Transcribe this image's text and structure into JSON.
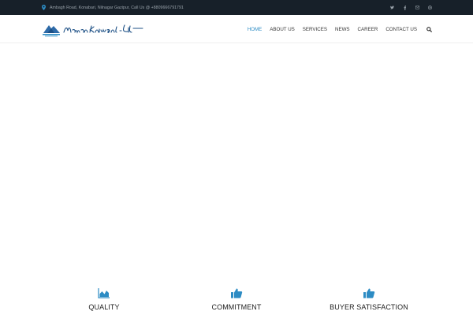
{
  "topbar": {
    "address": "Ambagh Road, Konabari, Nilnagar Gazipur, Call Us @ +8809666791791",
    "social_icons": [
      "twitter-icon",
      "facebook-icon",
      "email-icon",
      "pinterest-icon"
    ]
  },
  "header": {
    "logo_text": "Mamun Knitwear Ltd.",
    "nav": [
      {
        "label": "HOME",
        "active": true
      },
      {
        "label": "ABOUT US"
      },
      {
        "label": "SERVICES"
      },
      {
        "label": "NEWS"
      },
      {
        "label": "CAREER"
      },
      {
        "label": "CONTACT US"
      }
    ],
    "search_icon": "search-icon"
  },
  "features": [
    {
      "icon": "area-chart-icon",
      "label": "QUALITY"
    },
    {
      "icon": "thumbs-up-icon",
      "label": "COMMITMENT"
    },
    {
      "icon": "thumbs-up-icon",
      "label": "BUYER SATISFACTION"
    }
  ],
  "colors": {
    "topbar_bg": "#172029",
    "accent": "#2d8cc4",
    "nav_text": "#333333"
  }
}
